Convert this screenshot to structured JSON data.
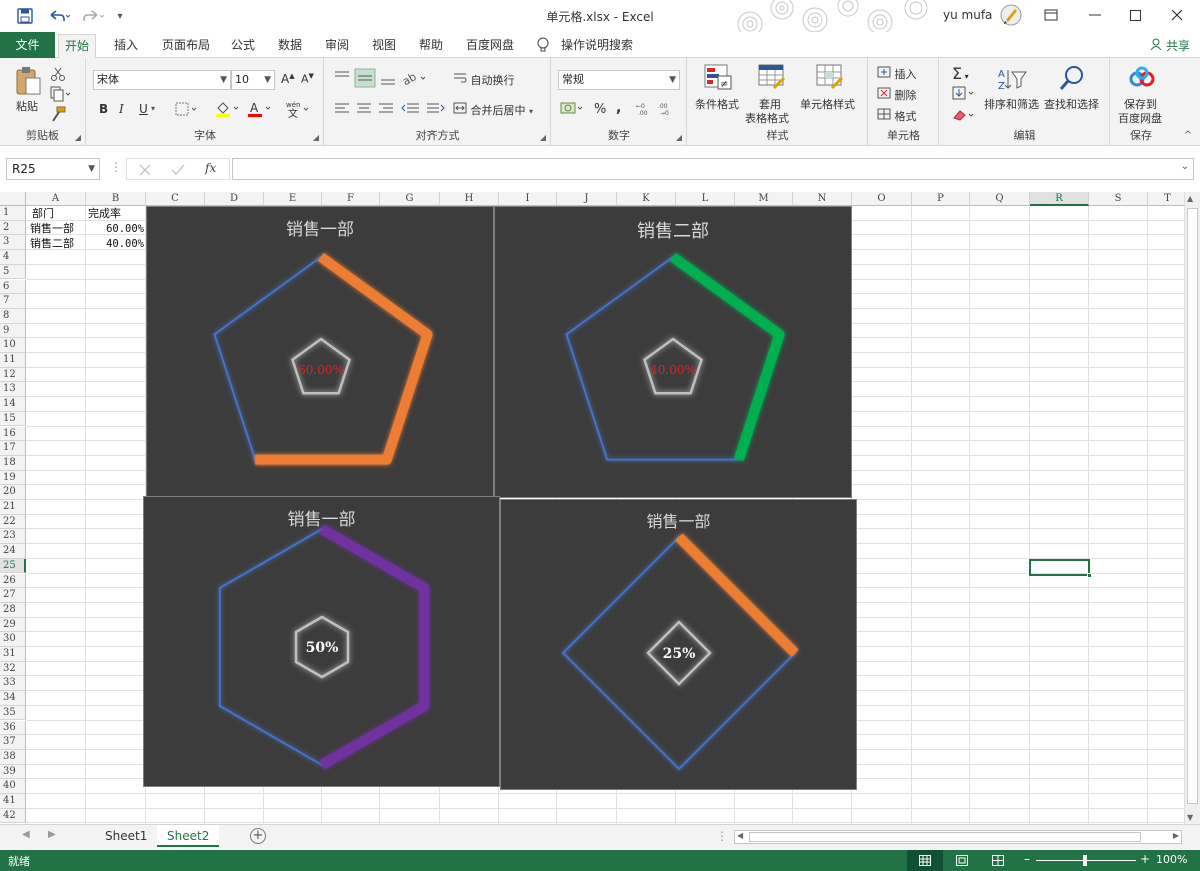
{
  "window": {
    "title": "单元格.xlsx  -  Excel",
    "user": "yu mufa"
  },
  "tabs": {
    "file": "文件",
    "items": [
      "开始",
      "插入",
      "页面布局",
      "公式",
      "数据",
      "审阅",
      "视图",
      "帮助",
      "百度网盘"
    ],
    "tell_me": "操作说明搜索",
    "share": "共享"
  },
  "ribbon": {
    "clipboard": {
      "label": "剪贴板",
      "paste": "粘贴"
    },
    "font": {
      "label": "字体",
      "name": "宋体",
      "size": "10",
      "bold": "B",
      "italic": "I",
      "underline": "U"
    },
    "alignment": {
      "label": "对齐方式",
      "wrap": "自动换行",
      "merge": "合并后居中"
    },
    "number": {
      "label": "数字",
      "format": "常规",
      "percent": "%",
      "comma": ","
    },
    "styles": {
      "label": "样式",
      "conditional": "条件格式",
      "table_line1": "套用",
      "table_line2": "表格格式",
      "cell_styles": "单元格样式"
    },
    "cells": {
      "label": "单元格",
      "insert": "插入",
      "delete": "删除",
      "format": "格式"
    },
    "editing": {
      "label": "编辑",
      "sort": "排序和筛选",
      "find": "查找和选择"
    },
    "save": {
      "label": "保存",
      "line1": "保存到",
      "line2": "百度网盘"
    }
  },
  "formula_bar": {
    "name_box": "R25",
    "fx": "fx",
    "value": ""
  },
  "columns": [
    "A",
    "B",
    "C",
    "D",
    "E",
    "F",
    "G",
    "H",
    "I",
    "J",
    "K",
    "L",
    "M",
    "N",
    "O",
    "P",
    "Q",
    "R",
    "S",
    "T"
  ],
  "rows": [
    "1",
    "2",
    "3",
    "4",
    "5",
    "6",
    "7",
    "8",
    "9",
    "10",
    "11",
    "12",
    "13",
    "14",
    "15",
    "16",
    "17",
    "18",
    "19",
    "20",
    "21",
    "22",
    "23",
    "24",
    "25",
    "26",
    "27",
    "28",
    "29",
    "30",
    "31",
    "32",
    "33",
    "34",
    "35",
    "36",
    "37",
    "38",
    "39",
    "40",
    "41",
    "42"
  ],
  "cells": {
    "a1": "部门",
    "b1": "完成率",
    "a2": "销售一部",
    "b2": "60.00%",
    "a3": "销售二部",
    "b3": "40.00%"
  },
  "charts": [
    {
      "title": "销售一部",
      "label": "60.00%",
      "progress": 0.6,
      "sides": 5,
      "color": "#ed7d31",
      "label_color": "#e0202a"
    },
    {
      "title": "销售二部",
      "label": "40.00%",
      "progress": 0.4,
      "sides": 5,
      "color": "#00b050",
      "label_color": "#e0202a"
    },
    {
      "title": "销售一部",
      "label": "50%",
      "progress": 0.5,
      "sides": 6,
      "color": "#7030a0",
      "label_color": "#ffffff"
    },
    {
      "title": "销售一部",
      "label": "25%",
      "progress": 0.25,
      "sides": 4,
      "color": "#ed7d31",
      "label_color": "#ffffff"
    }
  ],
  "sheets": {
    "items": [
      "Sheet1",
      "Sheet2"
    ],
    "active": "Sheet2"
  },
  "status": {
    "ready": "就绪",
    "zoom": "100%"
  },
  "colors": {
    "excel_green": "#217346",
    "chart_bg": "#3c3c3c",
    "track": "#4472c4"
  }
}
